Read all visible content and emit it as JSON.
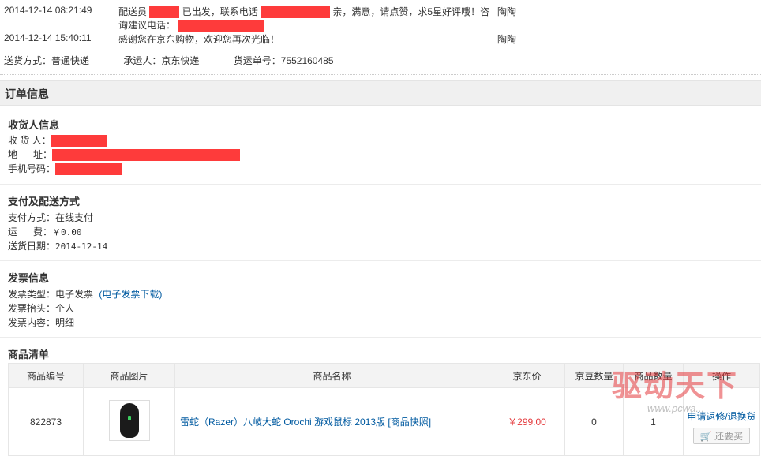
{
  "tracking": [
    {
      "time": "2014-12-14 08:21:49",
      "msg_a": "配送员",
      "msg_b": "已出发，联系电话",
      "msg_c": "亲，满意，请点赞，求5星好评哦！咨",
      "msg_d": "询建议电话：",
      "operator": "陶陶"
    },
    {
      "time": "2014-12-14 15:40:11",
      "msg_a": "感谢您在京东购物，欢迎您再次光临！",
      "operator": "陶陶"
    }
  ],
  "shipping": {
    "method_label": "送货方式：",
    "method_value": "普通快递",
    "carrier_label": "承运人：",
    "carrier_value": "京东快递",
    "tracking_label": "货运单号：",
    "tracking_value": "7552160485"
  },
  "order_info_title": "订单信息",
  "recipient": {
    "title": "收货人信息",
    "name_label": "收 货 人：",
    "addr_label": "地      址：",
    "phone_label": "手机号码："
  },
  "payment": {
    "title": "支付及配送方式",
    "pay_label": "支付方式：",
    "pay_value": "在线支付",
    "fee_label": "运      费：",
    "fee_value": "￥0.00",
    "date_label": "送货日期：",
    "date_value": "2014-12-14"
  },
  "invoice": {
    "title": "发票信息",
    "type_label": "发票类型：",
    "type_value": "电子发票",
    "download_link": "(电子发票下载)",
    "head_label": "发票抬头：",
    "head_value": "个人",
    "content_label": "发票内容：",
    "content_value": "明细"
  },
  "goods": {
    "title": "商品清单",
    "headers": [
      "商品编号",
      "商品图片",
      "商品名称",
      "京东价",
      "京豆数量",
      "商品数量",
      "操作"
    ],
    "row": {
      "id": "822873",
      "name": "雷蛇（Razer）八岐大蛇 Orochi 游戏鼠标 2013版 [商品快照]",
      "price": "￥299.00",
      "beans": "0",
      "qty": "1",
      "action": "申请返修/退换货",
      "buy_again": "还要买"
    }
  },
  "watermark": {
    "text": "驱动天下",
    "url": "www.pcwa..."
  },
  "colors": {
    "redaction": "#fe3b3b",
    "link": "#005aa0",
    "price": "#e4393c"
  }
}
